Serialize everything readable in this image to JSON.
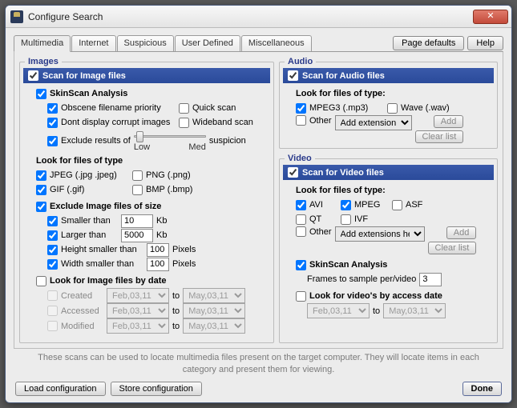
{
  "window": {
    "title": "Configure Search"
  },
  "topButtons": {
    "pageDefaults": "Page defaults",
    "help": "Help"
  },
  "tabs": [
    "Multimedia",
    "Internet",
    "Suspicious",
    "User Defined",
    "Miscellaneous"
  ],
  "images": {
    "legend": "Images",
    "scanLabel": "Scan for Image files",
    "skinscan": {
      "label": "SkinScan Analysis",
      "obscene": "Obscene filename priority",
      "quick": "Quick scan",
      "dontCorrupt": "Dont display corrupt images",
      "wideband": "Wideband scan",
      "excludeResults": "Exclude results of",
      "suspicion": "suspicion",
      "low": "Low",
      "med": "Med"
    },
    "lookFor": {
      "heading": "Look for files of type",
      "jpeg": "JPEG  (.jpg .jpeg)",
      "png": "PNG (.png)",
      "gif": "GIF  (.gif)",
      "bmp": "BMP (.bmp)"
    },
    "exclude": {
      "heading": "Exclude Image files of size",
      "smaller": "Smaller than",
      "smallerVal": "10",
      "kb": "Kb",
      "larger": "Larger than",
      "largerVal": "5000",
      "heightSmaller": "Height smaller than",
      "heightVal": "100",
      "px": "Pixels",
      "widthSmaller": "Width smaller than",
      "widthVal": "100"
    },
    "byDate": {
      "heading": "Look for Image files by date",
      "created": "Created",
      "accessed": "Accessed",
      "modified": "Modified",
      "to": "to",
      "from": "Feb,03,11",
      "toDate": "May,03,11"
    }
  },
  "audio": {
    "legend": "Audio",
    "scanLabel": "Scan for Audio files",
    "lookHeading": "Look for files of type:",
    "mpeg3": "MPEG3  (.mp3)",
    "wave": "Wave  (.wav)",
    "other": "Other",
    "addExt": "Add extension",
    "add": "Add",
    "clear": "Clear list"
  },
  "video": {
    "legend": "Video",
    "scanLabel": "Scan for Video files",
    "lookHeading": "Look for files of type:",
    "avi": "AVI",
    "mpeg": "MPEG",
    "asf": "ASF",
    "qt": "QT",
    "ivf": "IVF",
    "other": "Other",
    "addExt": "Add extensions here",
    "add": "Add",
    "clear": "Clear list",
    "skinscan": "SkinScan Analysis",
    "frames": "Frames to sample per/video",
    "framesVal": "3",
    "byDateHeading": "Look for video's by access date",
    "from": "Feb,03,11",
    "to": "to",
    "toDate": "May,03,11"
  },
  "note": "These scans can be used to locate multimedia files present on the target computer. They will locate items in each category and present them for viewing.",
  "footer": {
    "load": "Load configuration",
    "store": "Store configuration",
    "done": "Done"
  }
}
